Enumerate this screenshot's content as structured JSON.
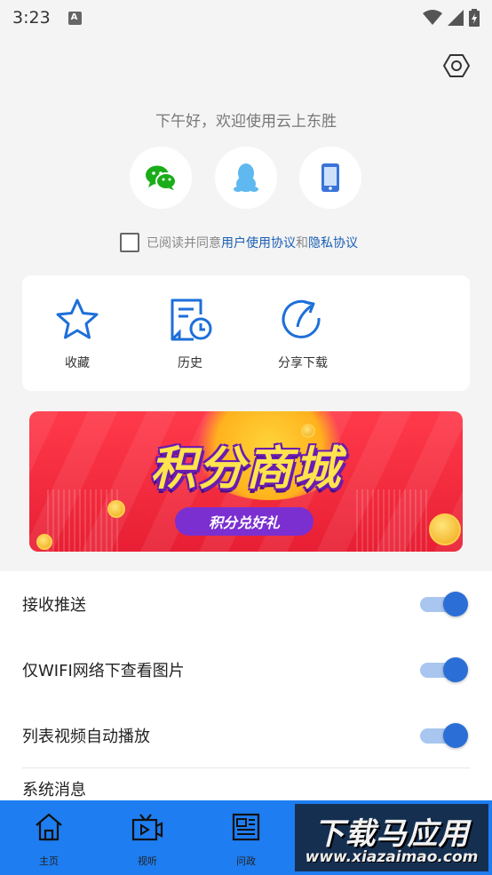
{
  "status_bar": {
    "time": "3:23",
    "notification_icon": "a-icon",
    "icons": [
      "wifi-icon",
      "signal-icon",
      "battery-charging-icon"
    ]
  },
  "header": {
    "settings_icon": "hexagon-settings-icon",
    "greeting": "下午好，欢迎使用云上东胜"
  },
  "login": {
    "buttons": [
      {
        "name": "wechat-login-button",
        "icon": "wechat-icon",
        "color": "#1aad19"
      },
      {
        "name": "qq-login-button",
        "icon": "qq-icon",
        "color": "#5fb8f0"
      },
      {
        "name": "phone-login-button",
        "icon": "phone-icon",
        "color": "#3a74d8"
      }
    ]
  },
  "agreement": {
    "prefix": "已阅读并同意",
    "user_agreement": "用户使用协议",
    "and": "和",
    "privacy_agreement": "隐私协议",
    "checked": false
  },
  "quick_actions": [
    {
      "label": "收藏",
      "icon": "star-icon"
    },
    {
      "label": "历史",
      "icon": "history-icon"
    },
    {
      "label": "分享下载",
      "icon": "share-icon"
    }
  ],
  "banner": {
    "title": "积分商城",
    "subtitle": "积分兑好礼"
  },
  "settings": [
    {
      "label": "接收推送",
      "enabled": true
    },
    {
      "label": "仅WIFI网络下查看图片",
      "enabled": true
    },
    {
      "label": "列表视频自动播放",
      "enabled": true
    }
  ],
  "partial_row": {
    "label": "系统消息"
  },
  "tabbar": {
    "tabs": [
      {
        "label": "主页",
        "icon": "home-icon"
      },
      {
        "label": "视听",
        "icon": "tv-icon"
      },
      {
        "label": "问政",
        "icon": "newspaper-icon"
      }
    ]
  },
  "watermark": {
    "title": "下载马应用",
    "url": "www.xiazaimao.com"
  },
  "colors": {
    "accent": "#2b6fd6",
    "tabbar": "#1e7df0",
    "link": "#1a5fb4",
    "background": "#f4f4f4"
  }
}
